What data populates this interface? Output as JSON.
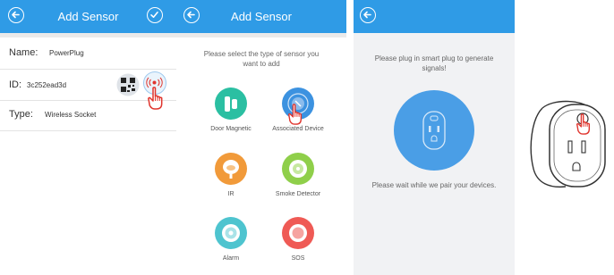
{
  "screen1": {
    "title": "Add Sensor",
    "name_label": "Name:",
    "name_value": "PowerPlug",
    "id_label": "ID:",
    "id_value": "3c252ead3d",
    "type_label": "Type:",
    "type_value": "Wireless Socket"
  },
  "screen2": {
    "title": "Add Sensor",
    "prompt": "Please select the type of sensor you want to add",
    "sensors": [
      {
        "label": "Door Magnetic",
        "color": "#2bbfa2"
      },
      {
        "label": "Associated Device",
        "color": "#3c92e0"
      },
      {
        "label": "IR",
        "color": "#f19a3a"
      },
      {
        "label": "Smoke Detector",
        "color": "#8fcf4a"
      },
      {
        "label": "Alarm",
        "color": "#4ec4cf"
      },
      {
        "label": "SOS",
        "color": "#ef5a55"
      }
    ]
  },
  "screen3": {
    "prompt": "Please plug in smart plug to generate signals!",
    "wait_text": "Please wait while we pair your devices."
  },
  "colors": {
    "bar": "#2f9be6",
    "accent_red": "#e0352e"
  }
}
